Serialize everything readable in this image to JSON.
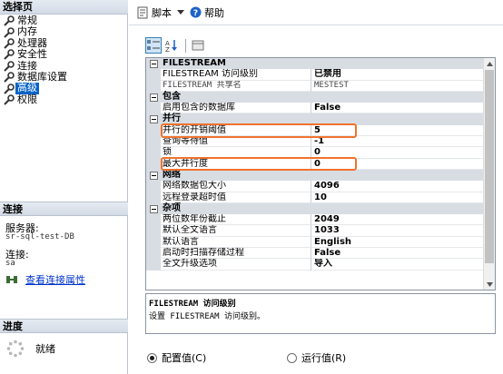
{
  "left": {
    "select_page_header": "选择页",
    "pages": [
      {
        "label": "常规",
        "selected": false
      },
      {
        "label": "内存",
        "selected": false
      },
      {
        "label": "处理器",
        "selected": false
      },
      {
        "label": "安全性",
        "selected": false
      },
      {
        "label": "连接",
        "selected": false
      },
      {
        "label": "数据库设置",
        "selected": false
      },
      {
        "label": "高级",
        "selected": true
      },
      {
        "label": "权限",
        "selected": false
      }
    ],
    "connection_header": "连接",
    "server_label": "服务器:",
    "server_value": "sr-sql-test-DB",
    "login_label": "连接:",
    "login_value": "sa",
    "view_conn_link": "查看连接属性",
    "progress_header": "进度",
    "progress_status": "就绪"
  },
  "toolbar": {
    "script_label": "脚本",
    "help_label": "帮助"
  },
  "grid": {
    "rows": [
      {
        "kind": "cat",
        "expanded": true,
        "name": "FILESTREAM",
        "mono": true
      },
      {
        "kind": "prop",
        "name": "FILESTREAM 访问级别",
        "value": "已禁用"
      },
      {
        "kind": "prop",
        "name": "FILESTREAM 共享名",
        "value": "MESTEST",
        "mono": true
      },
      {
        "kind": "cat",
        "expanded": true,
        "name": "包含"
      },
      {
        "kind": "prop",
        "name": "启用包含的数据库",
        "value": "False"
      },
      {
        "kind": "cat",
        "expanded": true,
        "name": "并行"
      },
      {
        "kind": "prop",
        "name": "并行的开销阈值",
        "value": "5",
        "highlight": true
      },
      {
        "kind": "prop",
        "name": "查询等待值",
        "value": "-1"
      },
      {
        "kind": "prop",
        "name": "锁",
        "value": "0"
      },
      {
        "kind": "prop",
        "name": "最大并行度",
        "value": "0",
        "highlight": true
      },
      {
        "kind": "cat",
        "expanded": true,
        "name": "网络"
      },
      {
        "kind": "prop",
        "name": "网络数据包大小",
        "value": "4096"
      },
      {
        "kind": "prop",
        "name": "远程登录超时值",
        "value": "10"
      },
      {
        "kind": "cat",
        "expanded": true,
        "name": "杂项"
      },
      {
        "kind": "prop",
        "name": "两位数年份截止",
        "value": "2049"
      },
      {
        "kind": "prop",
        "name": "默认全文语言",
        "value": "1033"
      },
      {
        "kind": "prop",
        "name": "默认语言",
        "value": "English"
      },
      {
        "kind": "prop",
        "name": "启动时扫描存储过程",
        "value": "False"
      },
      {
        "kind": "prop",
        "name": "全文升级选项",
        "value": "导入"
      }
    ]
  },
  "description": {
    "title": "FILESTREAM 访问级别",
    "text": "设置 FILESTREAM 访问级别。"
  },
  "radios": {
    "config_label": "配置值(C)",
    "running_label": "运行值(R)",
    "config_selected": true
  },
  "colors": {
    "highlight": "#f0722e",
    "selection": "#0a64c8",
    "link": "#0033cc"
  }
}
